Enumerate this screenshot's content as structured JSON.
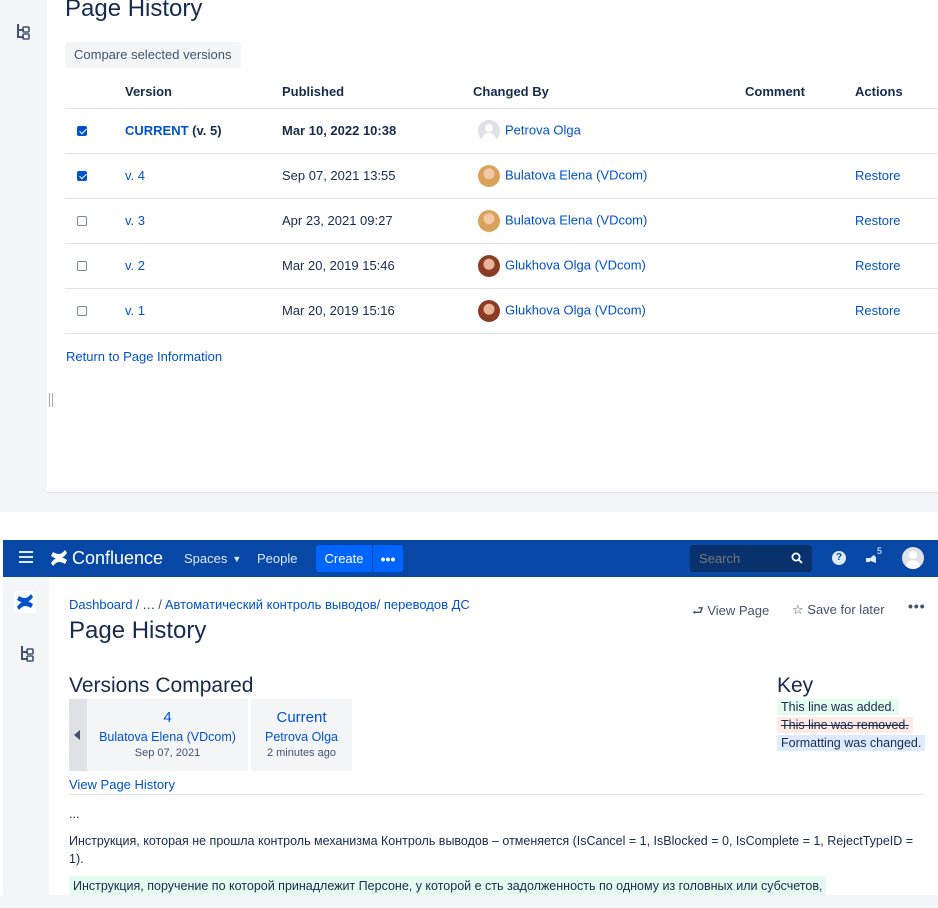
{
  "top_panel": {
    "title": "Page History",
    "compare_button": "Compare selected versions",
    "columns": {
      "version": "Version",
      "published": "Published",
      "changed_by": "Changed By",
      "comment": "Comment",
      "actions": "Actions"
    },
    "rows": [
      {
        "checked": true,
        "version": "CURRENT",
        "version_suffix": " (v. 5)",
        "published": "Mar 10, 2022 10:38",
        "changed_by": "Petrova Olga",
        "comment": "",
        "action": ""
      },
      {
        "checked": true,
        "version": "v. 4",
        "version_suffix": "",
        "published": "Sep 07, 2021 13:55",
        "changed_by": "Bulatova Elena (VDcom)",
        "comment": "",
        "action": "Restore"
      },
      {
        "checked": false,
        "version": "v. 3",
        "version_suffix": "",
        "published": "Apr 23, 2021 09:27",
        "changed_by": "Bulatova Elena (VDcom)",
        "comment": "",
        "action": "Restore"
      },
      {
        "checked": false,
        "version": "v. 2",
        "version_suffix": "",
        "published": "Mar 20, 2019 15:46",
        "changed_by": "Glukhova Olga (VDcom)",
        "comment": "",
        "action": "Restore"
      },
      {
        "checked": false,
        "version": "v. 1",
        "version_suffix": "",
        "published": "Mar 20, 2019 15:16",
        "changed_by": "Glukhova Olga (VDcom)",
        "comment": "",
        "action": "Restore"
      }
    ],
    "return_link": "Return to Page Information"
  },
  "navbar": {
    "brand": "Confluence",
    "spaces": "Spaces",
    "people": "People",
    "create": "Create",
    "more": "•••",
    "search_placeholder": "Search",
    "help": "?",
    "notification_count": "5"
  },
  "page": {
    "breadcrumb": {
      "dashboard": "Dashboard",
      "ellipsis": "…",
      "parent": "Автоматический контроль выводов/ переводов ДС"
    },
    "title": "Page History",
    "view_page": "View Page",
    "save_for_later": "Save for later",
    "more": "•••"
  },
  "compare": {
    "title": "Versions Compared",
    "left": {
      "number": "4",
      "author": "Bulatova Elena (VDcom)",
      "date": "Sep 07, 2021"
    },
    "right": {
      "number": "Current",
      "author": "Petrova Olga",
      "date": "2 minutes ago"
    },
    "view_history": "View Page History"
  },
  "key": {
    "title": "Key",
    "added": "This line was added.",
    "removed": "This line was removed.",
    "changed": "Formatting was changed."
  },
  "diff_body": {
    "dots": "...",
    "paragraph1": "Инструкция, которая не прошла контроль механизма Контроль выводов – отменяется (IsCancel = 1, IsBlocked = 0, IsComplete = 1, RejectTypeID = 1).",
    "paragraph2_added": "Инструкция, поручение по которой принадлежит Персоне, у которой е  сть задолженность по одному из головных или субсчетов,"
  },
  "colors": {
    "nav_bg": "#0747a6",
    "link": "#0052cc",
    "added_bg": "#e3fcef",
    "removed_bg": "#ffebe6",
    "changed_bg": "#deebff"
  }
}
